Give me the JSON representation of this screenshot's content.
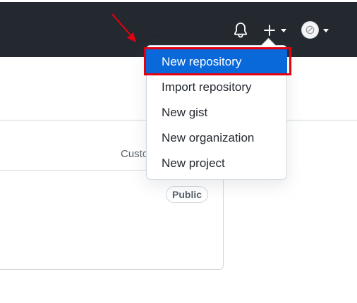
{
  "header": {
    "bell_icon": "bell-icon",
    "plus_icon": "plus-icon",
    "avatar_icon": "avatar-icon"
  },
  "menu": {
    "items": [
      {
        "label": "New repository",
        "active": true
      },
      {
        "label": "Import repository",
        "active": false
      },
      {
        "label": "New gist",
        "active": false
      },
      {
        "label": "New organization",
        "active": false
      },
      {
        "label": "New project",
        "active": false
      }
    ]
  },
  "content": {
    "custom_label": "Custo",
    "public_badge": "Public"
  },
  "annotations": {
    "highlight_color": "#e3000f",
    "arrow_color": "#e3000f"
  },
  "colors": {
    "header_bg": "#24292f",
    "active_bg": "#0969da"
  }
}
